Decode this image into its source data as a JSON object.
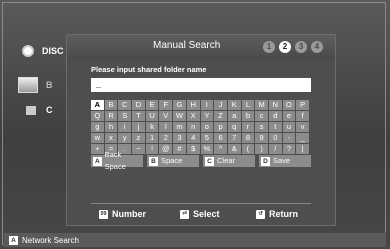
{
  "sidebar": {
    "disc_label": "DISC",
    "pc_label": "B",
    "usb_label": "C"
  },
  "dialog": {
    "title": "Manual Search",
    "steps": [
      "1",
      "2",
      "3",
      "4"
    ],
    "active_step": "2",
    "prompt": "Please input shared folder name",
    "input_value": "_",
    "keyboard_rows": [
      [
        "A",
        "B",
        "C",
        "D",
        "E",
        "F",
        "G",
        "H",
        "I",
        "J",
        "K",
        "L",
        "M",
        "N",
        "O",
        "P"
      ],
      [
        "Q",
        "R",
        "S",
        "T",
        "U",
        "V",
        "W",
        "X",
        "Y",
        "Z",
        "a",
        "b",
        "c",
        "d",
        "e",
        "f"
      ],
      [
        "g",
        "h",
        "i",
        "j",
        "k",
        "l",
        "m",
        "n",
        "o",
        "p",
        "q",
        "r",
        "s",
        "t",
        "u",
        "v"
      ],
      [
        "w",
        "x",
        "y",
        "z",
        "1",
        "2",
        "3",
        "4",
        "5",
        "6",
        "7",
        "8",
        "9",
        "0",
        "-",
        "_"
      ],
      [
        "+",
        "=",
        ".",
        "~",
        "!",
        "@",
        "#",
        "$",
        "%",
        "^",
        "&",
        "(",
        ")",
        "/",
        "?",
        "|"
      ]
    ],
    "selected_key": "A",
    "actions": [
      {
        "badge": "A",
        "label": "Back Space",
        "icon": "a-button-icon"
      },
      {
        "badge": "B",
        "label": "Space",
        "icon": "b-button-icon"
      },
      {
        "badge": "C",
        "label": "Clear",
        "icon": "c-button-icon"
      },
      {
        "badge": "D",
        "label": "Save",
        "icon": "d-button-icon"
      }
    ],
    "footer": {
      "number_icon": "09",
      "number_label": "Number",
      "select_label": "Select",
      "return_label": "Return"
    }
  },
  "bottom_bar": {
    "badge": "A",
    "label": "Network Search"
  }
}
